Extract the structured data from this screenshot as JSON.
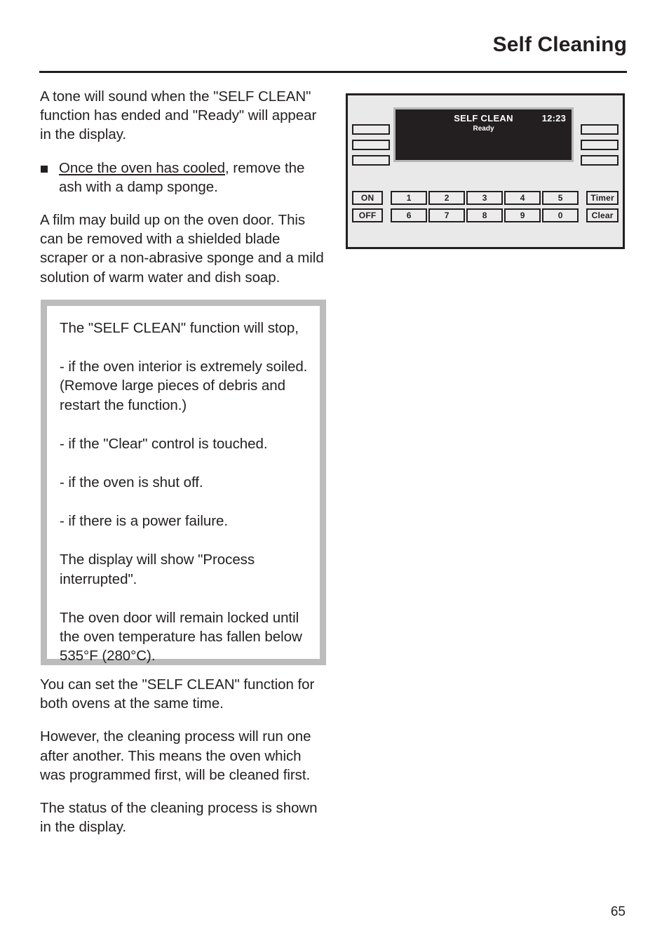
{
  "header": {
    "title": "Self Cleaning"
  },
  "left_column": {
    "paragraph_1": "A tone will sound when the \"SELF CLEAN\" function has ended and \"Ready\" will appear in the display.",
    "bullet": {
      "marker": "square-bullet",
      "underlined_text": "Once the oven has cooled",
      "rest_text": ", remove the ash with a damp sponge."
    },
    "paragraph_2": "A film may build up on the oven door. This can be removed with a shielded blade scraper or a non-abrasive sponge and a mild solution of warm water and dish soap."
  },
  "note_box": {
    "border_color": "#bcbcbc",
    "paragraphs": [
      "The \"SELF CLEAN\" function will stop,",
      "- if the oven interior is extremely soiled. (Remove large pieces of debris and restart the function.)",
      "- if the \"Clear\" control is touched.",
      "- if the oven is shut off.",
      "- if there is a power failure.",
      "The display will show \"Process interrupted\".",
      "The oven door will remain locked until the oven temperature has fallen below 535°F (280°C)."
    ]
  },
  "tail_text": {
    "paragraph_1": "You can set the \"SELF CLEAN\" function for both ovens at the same time.",
    "paragraph_2": "However, the cleaning process will run one after another. This means the oven which was programmed first, will be cleaned first.",
    "paragraph_3": "The status of the cleaning process is shown in the display."
  },
  "control_panel": {
    "display": {
      "title": "SELF CLEAN",
      "clock": "12:23",
      "status": "Ready",
      "screen_color": "#231f20",
      "bezel_color": "#b7b7b7"
    },
    "left_keys": [
      "",
      "",
      ""
    ],
    "right_keys": [
      "",
      "",
      ""
    ],
    "power_keys": [
      "ON",
      "OFF"
    ],
    "digit_row_1": [
      "1",
      "2",
      "3",
      "4",
      "5"
    ],
    "digit_row_2": [
      "6",
      "7",
      "8",
      "9",
      "0"
    ],
    "function_keys": [
      "Timer",
      "Clear"
    ],
    "panel_background": "#e9e9e9"
  },
  "footer": {
    "page_number": "65"
  }
}
